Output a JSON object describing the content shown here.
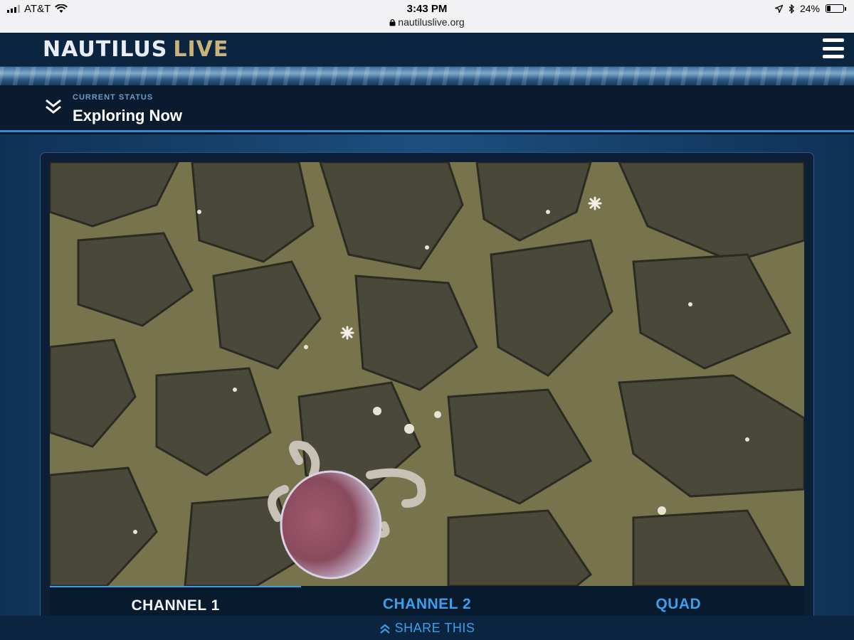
{
  "status_bar": {
    "carrier": "AT&T",
    "time": "3:43 PM",
    "url": "nautiluslive.org",
    "battery": "24%",
    "battery_level": 0.24
  },
  "header": {
    "logo_part1": "NAUTILUS",
    "logo_part2": "LIVE",
    "menu_icon": "hamburger-menu-icon"
  },
  "current_status": {
    "label": "CURRENT STATUS",
    "value": "Exploring Now",
    "toggle_icon": "double-chevron-down-icon"
  },
  "video": {
    "description_icon": "live-video-feed"
  },
  "channels": {
    "tabs": [
      {
        "label": "CHANNEL 1",
        "active": true
      },
      {
        "label": "CHANNEL 2",
        "active": false
      },
      {
        "label": "QUAD",
        "active": false
      }
    ]
  },
  "share": {
    "label": "SHARE THIS",
    "icon": "double-chevron-up-icon"
  },
  "colors": {
    "accent_blue": "#3aa0ec",
    "header_navy": "#0b2440",
    "logo_gold": "#c9b37a"
  }
}
